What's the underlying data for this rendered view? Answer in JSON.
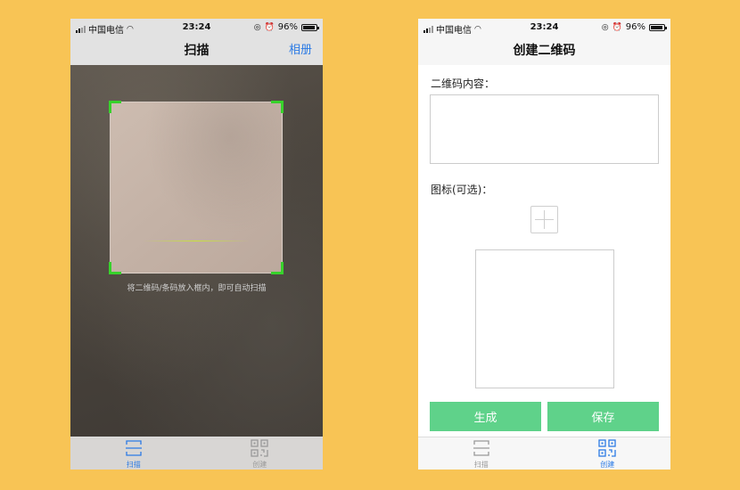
{
  "status_bar": {
    "carrier": "中国电信",
    "time": "23:24",
    "battery": "96%",
    "battery_level": 0.96
  },
  "scan_screen": {
    "title": "扫描",
    "album_button": "相册",
    "hint": "将二维码/条码放入框内，即可自动扫描"
  },
  "create_screen": {
    "title": "创建二维码",
    "content_label": "二维码内容：",
    "content_value": "",
    "icon_label": "图标(可选)：",
    "generate_button": "生成",
    "save_button": "保存"
  },
  "tabs": [
    {
      "label": "扫描",
      "icon": "scan-icon"
    },
    {
      "label": "创建",
      "icon": "qrcode-icon"
    }
  ],
  "colors": {
    "background": "#f8c455",
    "accent": "#2c7be5",
    "button": "#5fd28a",
    "scan_corner": "#37d22b"
  }
}
